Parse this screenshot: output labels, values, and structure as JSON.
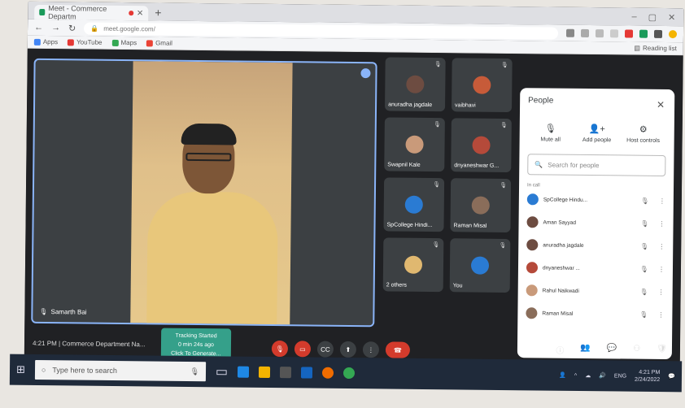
{
  "browser": {
    "tab_title": "Meet - Commerce Departm",
    "new_tab": "+",
    "url": "meet.google.com/",
    "bookmarks": [
      {
        "label": "Apps",
        "color": "#4285f4"
      },
      {
        "label": "YouTube",
        "color": "#e53935"
      },
      {
        "label": "Maps",
        "color": "#34a853"
      },
      {
        "label": "Gmail",
        "color": "#ea4335"
      }
    ],
    "reading_list": "Reading list"
  },
  "main_tile": {
    "name": "Samarth Bai"
  },
  "tiles": [
    {
      "name": "anuradha jagdale",
      "avatar_color": "#6d4c41"
    },
    {
      "name": "vaibhavi",
      "avatar_color": "#c75b39"
    },
    {
      "name": "Swapnil Kale",
      "avatar_color": "#c99a7a"
    },
    {
      "name": "dnyaneshwar G...",
      "avatar_color": "#b54a3a"
    },
    {
      "name": "SpCollege Hindi...",
      "avatar_color": "#2a7bd3"
    },
    {
      "name": "Raman Misal",
      "avatar_color": "#8a6d5a"
    },
    {
      "name": "2 others",
      "avatar_color": "#e0b870"
    },
    {
      "name": "You",
      "avatar_color": "#2a7bd3"
    }
  ],
  "people_panel": {
    "title": "People",
    "actions": [
      "Mute all",
      "Add people",
      "Host controls"
    ],
    "search_placeholder": "Search for people",
    "section": "In call",
    "people": [
      {
        "name": "SpCollege Hindu...",
        "color": "#2a7bd3"
      },
      {
        "name": "Aman Sayyad",
        "color": "#6d4c41"
      },
      {
        "name": "anuradha jagdale",
        "color": "#6d4c41"
      },
      {
        "name": "dnyaneshwar ...",
        "color": "#b54a3a"
      },
      {
        "name": "Rahul Naikwadi",
        "color": "#c99a7a"
      },
      {
        "name": "Raman Misal",
        "color": "#8a6d5a"
      }
    ]
  },
  "bottom": {
    "meeting_info": "4:21 PM | Commerce Department Na...",
    "tracking_line1": "Tracking Started",
    "tracking_line2": "0 min 24s ago",
    "tracking_line3": "Click To Generate..."
  },
  "taskbar": {
    "search_placeholder": "Type here to search",
    "lang": "ENG",
    "time": "4:21 PM",
    "date": "2/24/2022"
  }
}
